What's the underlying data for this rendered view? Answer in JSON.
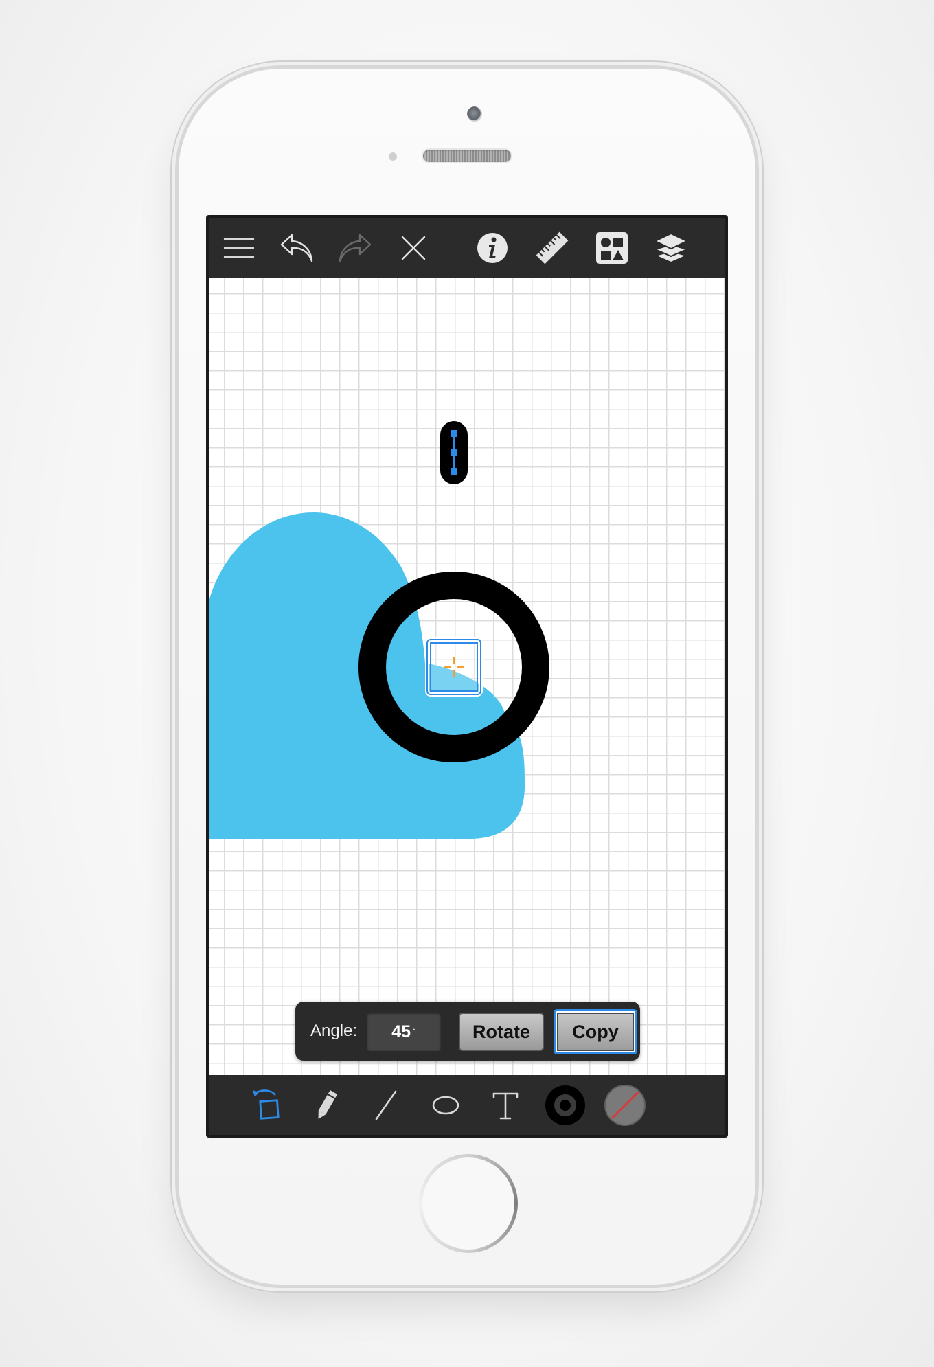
{
  "toolbar": {
    "items": [
      {
        "name": "menu",
        "icon": "hamburger-icon"
      },
      {
        "name": "undo",
        "icon": "undo-arrow-icon"
      },
      {
        "name": "redo",
        "icon": "redo-arrow-icon",
        "disabled": true
      },
      {
        "name": "close",
        "icon": "close-x-icon"
      },
      {
        "name": "info",
        "icon": "info-icon"
      },
      {
        "name": "ruler",
        "icon": "ruler-icon"
      },
      {
        "name": "shapes",
        "icon": "shapes-library-icon"
      },
      {
        "name": "layers",
        "icon": "layers-icon"
      }
    ]
  },
  "angle_panel": {
    "label": "Angle:",
    "value": "45",
    "unit": "˚",
    "rotate_label": "Rotate",
    "copy_label": "Copy"
  },
  "bottom_tools": {
    "items": [
      {
        "name": "select-transform",
        "icon": "select-transform-icon",
        "active": true
      },
      {
        "name": "pencil",
        "icon": "pencil-icon"
      },
      {
        "name": "line",
        "icon": "line-icon"
      },
      {
        "name": "ellipse",
        "icon": "ellipse-icon"
      },
      {
        "name": "text",
        "icon": "text-T-icon"
      },
      {
        "name": "stroke-color",
        "icon": "stroke-color-icon"
      },
      {
        "name": "fill-color",
        "icon": "no-fill-icon"
      }
    ]
  },
  "colors": {
    "accent": "#2b8be6",
    "cloud_fill": "#4cc3ec",
    "toolbar_bg": "#2b2b2b",
    "stroke": "#000000"
  }
}
